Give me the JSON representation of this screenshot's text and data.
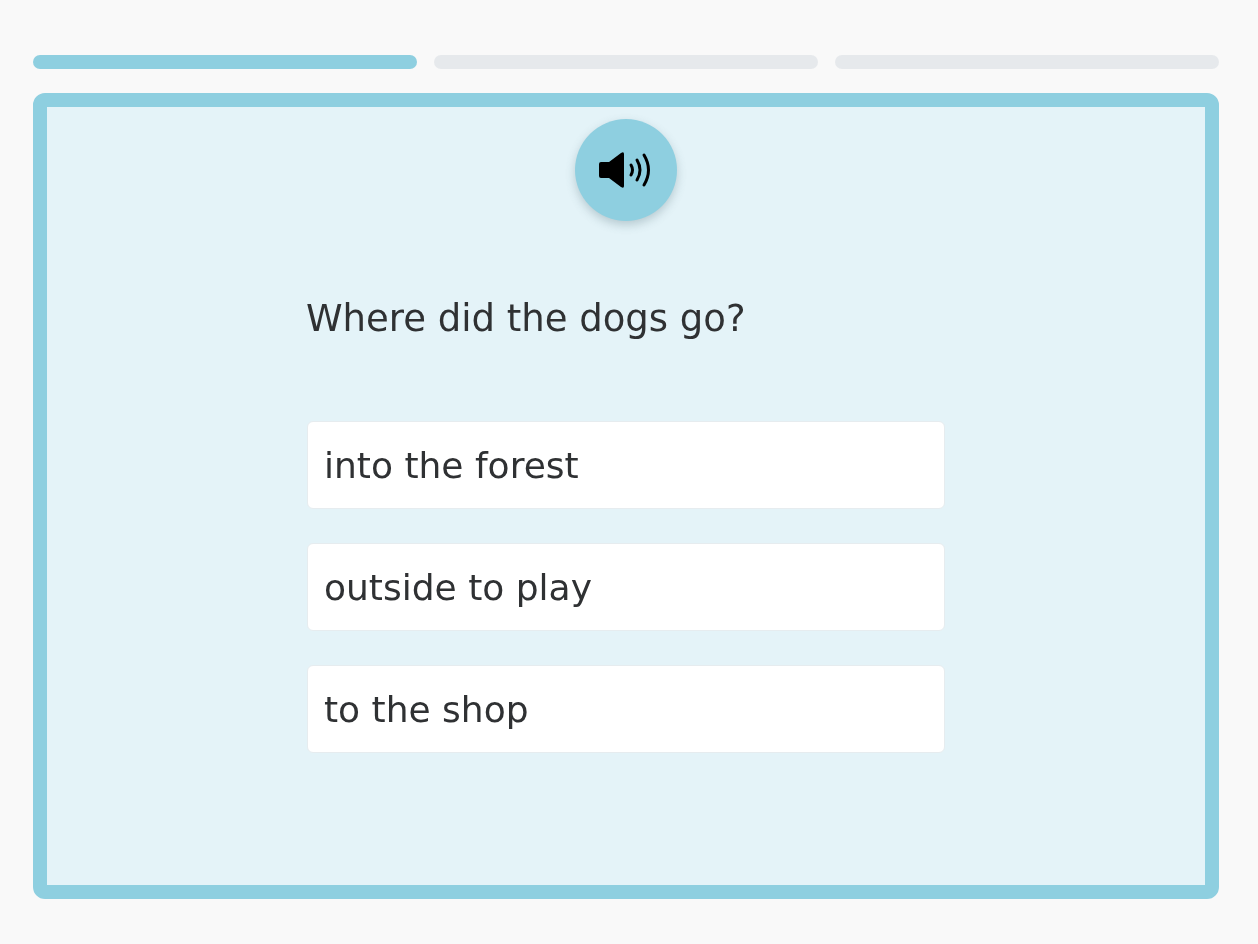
{
  "progress": [
    {
      "completed": true
    },
    {
      "completed": false
    },
    {
      "completed": false
    }
  ],
  "question": {
    "text": "Where did the dogs go?"
  },
  "options": [
    {
      "text": "into the forest",
      "selected": false
    },
    {
      "text": "outside to play",
      "selected": false
    },
    {
      "text": "to the shop",
      "selected": false
    }
  ]
}
